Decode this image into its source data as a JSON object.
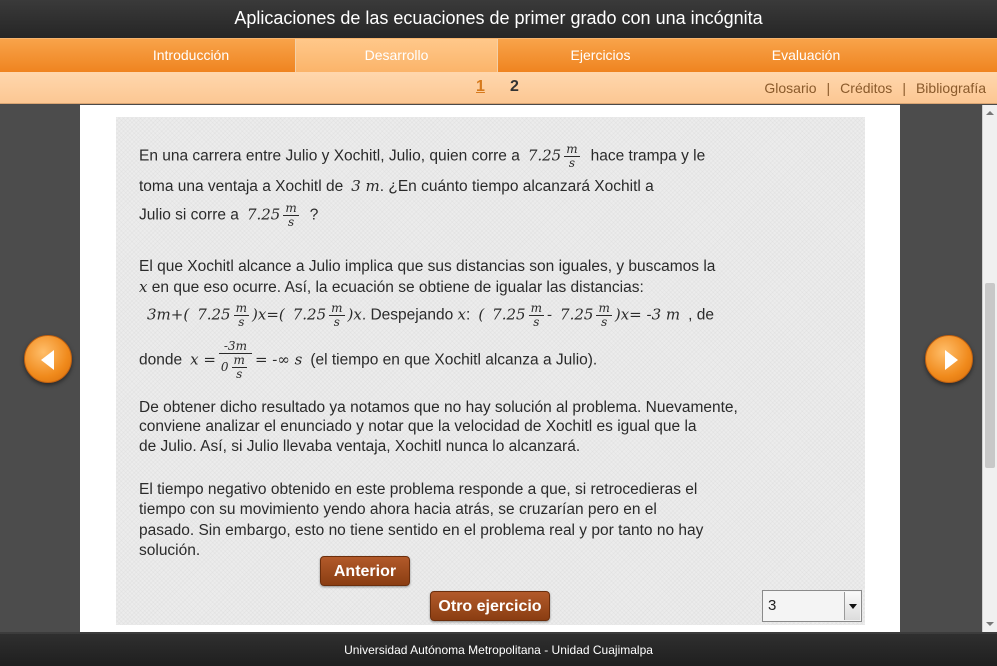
{
  "title": "Aplicaciones de las ecuaciones de primer grado con una incógnita",
  "nav": {
    "tabs": [
      {
        "label": "Introducción",
        "active": false
      },
      {
        "label": "Desarrollo",
        "active": true
      },
      {
        "label": "Ejercicios",
        "active": false
      },
      {
        "label": "Evaluación",
        "active": false
      }
    ]
  },
  "pager": {
    "page1": "1",
    "page2": "2"
  },
  "links": {
    "glosario": "Glosario",
    "sep": "|",
    "creditos": "Créditos",
    "bibliografia": "Bibliografía"
  },
  "content": {
    "p1_l1a": "En una carrera entre Julio y Xochitl, Julio, quien corre a",
    "v725": "7.25",
    "unit_m": "m",
    "unit_s": "s",
    "p1_l1b": "hace trampa y le",
    "p1_l2a": "toma una ventaja a Xochitl de",
    "p1_l2m": "3 m",
    "p1_l2b": ". ¿En cuánto tiempo alcanzará Xochitl a",
    "p1_l3a": "Julio si corre a",
    "p1_l3b": "?",
    "p2_l1": "El que Xochitl alcance a Julio implica que sus distancias son iguales, y buscamos la",
    "p2_l2x": "x",
    "p2_l2": " en que eso ocurre. Así, la ecuación se obtiene de igualar las distancias:",
    "eq_3m": "3m",
    "eq_plus_open": "+(",
    "eq_close": ")",
    "eq_x": "x",
    "eq_eq_open": "=(",
    "eq_despejando": ". Despejando ",
    "eq_colon": ":",
    "eq_open": "(",
    "eq_minus": "-",
    "eq_eq_neg3m": "= -3 m",
    "eq_comma_de": ", de",
    "p3_donde": "donde",
    "p3_xeq": "x =",
    "p3_num": "-3m",
    "p3_den0": "0",
    "p3_result": "= -∞ s",
    "p3_tail": "(el tiempo en que Xochitl alcanza a Julio).",
    "p4_l1": "De obtener dicho resultado ya notamos que no hay solución al problema. Nuevamente,",
    "p4_l2": "conviene analizar el enunciado y notar que la velocidad de Xochitl es   igual   que la",
    "p4_l3": "de Julio. Así, si Julio llevaba ventaja, Xochitl nunca lo alcanzará.",
    "p5_l1": "El tiempo negativo obtenido en este problema responde a que, si retrocedieras el",
    "p5_l2": "tiempo con su movimiento yendo ahora hacia atrás, se cruzarían pero en el",
    "p5_l3": "pasado. Sin embargo, esto no tiene sentido en el problema real y por tanto no hay",
    "p5_l4": "solución."
  },
  "buttons": {
    "anterior": "Anterior",
    "otro": "Otro ejercicio"
  },
  "select": {
    "value": "3"
  },
  "footer": "Universidad Autónoma Metropolitana - Unidad Cuajimalpa",
  "colors": {
    "accent": "#f39234",
    "button": "#9c4a1c",
    "header": "#2e2e2e"
  }
}
